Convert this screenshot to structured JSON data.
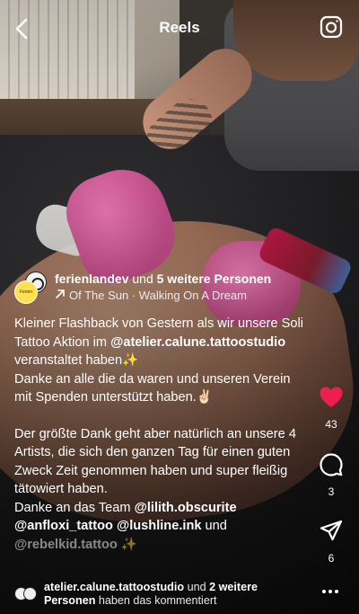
{
  "header": {
    "title": "Reels"
  },
  "author": {
    "username": "ferienlandev",
    "connector": "und",
    "others": "5 weitere Personen",
    "audio": "Of The Sun · Walking On A Dream",
    "avatar_text": "Ferien Land"
  },
  "caption": {
    "p1_a": "Kleiner Flashback von Gestern als wir unsere Soli Tattoo Aktion im",
    "p1_mention": "@atelier.calune.tattoostudio",
    "p1_b": "veranstaltet haben✨",
    "p2": "Danke an alle die da waren und unseren Verein mit Spenden unterstützt haben.✌🏻",
    "p3": "Der größte Dank geht aber natürlich an unsere 4 Artists, die sich den ganzen Tag für einen guten Zweck Zeit genommen haben und super fleißig tätowiert haben.",
    "p4_a": "Danke an das Team",
    "m1": "@lilith.obscurite",
    "m2": "@anfloxi_tattoo",
    "m3": "@lushline.ink",
    "p4_und": "und",
    "m4": "@rebelkid.tattoo",
    "p4_end": "✨"
  },
  "actions": {
    "like_count": "43",
    "comment_count": "3",
    "share_count": "6",
    "like_color": "#ee1d52"
  },
  "commenters": {
    "user": "atelier.calune.tattoostudio",
    "connector": "und",
    "others": "2 weitere Personen",
    "suffix": "haben das kommentiert"
  },
  "icons": [
    "back-chevron-icon",
    "camera-icon",
    "heart-icon",
    "comment-icon",
    "share-icon",
    "more-icon",
    "trending-arrow-icon"
  ]
}
